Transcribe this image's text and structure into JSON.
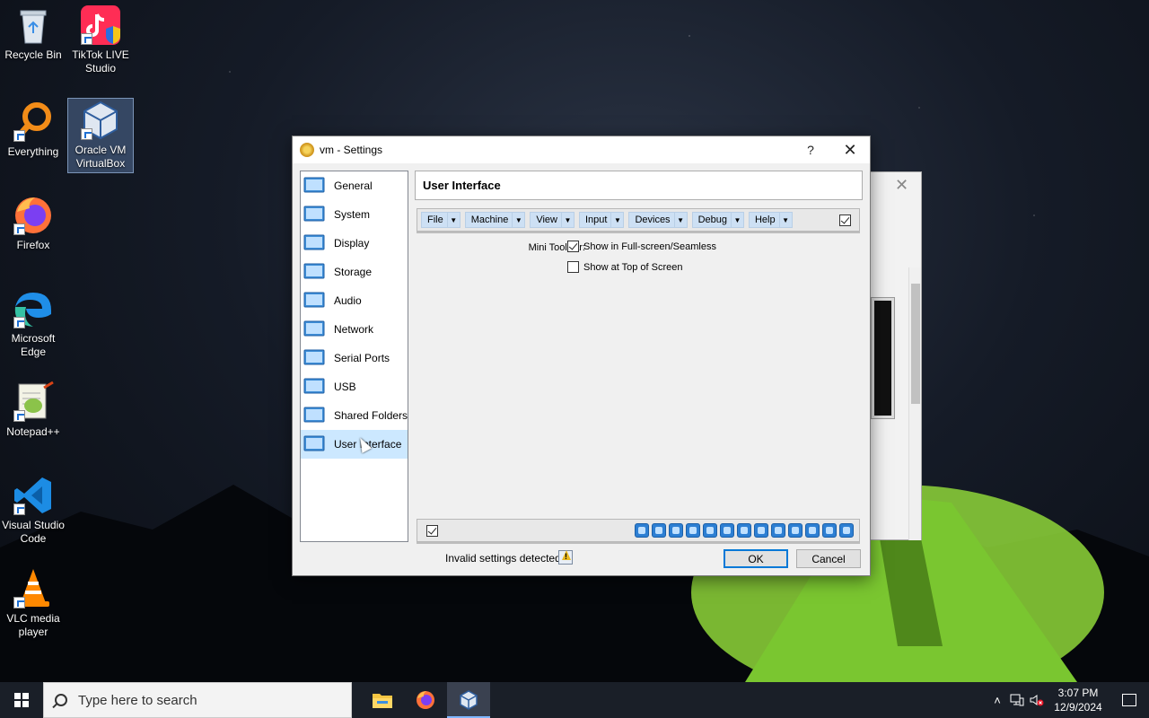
{
  "desktop": {
    "icons": [
      {
        "label": "Recycle Bin"
      },
      {
        "label": "TikTok LIVE Studio"
      },
      {
        "label": "Everything"
      },
      {
        "label": "Oracle VM VirtualBox"
      },
      {
        "label": "Firefox"
      },
      {
        "label": "Microsoft Edge"
      },
      {
        "label": "Notepad++"
      },
      {
        "label": "Visual Studio Code"
      },
      {
        "label": "VLC media player"
      }
    ]
  },
  "dialog": {
    "title": "vm - Settings",
    "help_glyph": "?",
    "close_glyph": "✕",
    "nav": [
      {
        "label": "General",
        "icon": "general-icon"
      },
      {
        "label": "System",
        "icon": "system-icon"
      },
      {
        "label": "Display",
        "icon": "display-icon"
      },
      {
        "label": "Storage",
        "icon": "storage-icon"
      },
      {
        "label": "Audio",
        "icon": "audio-icon"
      },
      {
        "label": "Network",
        "icon": "network-icon"
      },
      {
        "label": "Serial Ports",
        "icon": "serial-ports-icon"
      },
      {
        "label": "USB",
        "icon": "usb-icon"
      },
      {
        "label": "Shared Folders",
        "icon": "shared-folders-icon"
      },
      {
        "label": "User Interface",
        "icon": "user-interface-icon",
        "active": true
      }
    ],
    "page_title": "User Interface",
    "menubar": {
      "items": [
        "File",
        "Machine",
        "View",
        "Input",
        "Devices",
        "Debug",
        "Help"
      ],
      "enabled": true
    },
    "mini_toolbar": {
      "label": "Mini ToolBar:",
      "show_fullscreen": {
        "label": "Show in Full-screen/Seamless",
        "checked": true
      },
      "show_top": {
        "label": "Show at Top of Screen",
        "checked": false
      }
    },
    "statusbar": {
      "enabled": true,
      "icons": [
        "hard-disk-icon",
        "optical-drive-icon",
        "floppy-icon",
        "audio-icon",
        "network-icon",
        "usb-icon",
        "shared-folder-icon",
        "display-icon",
        "recording-icon",
        "mouse-integration-icon",
        "keyboard-icon",
        "cpu-icon",
        "download-icon"
      ]
    },
    "footer": {
      "message": "Invalid settings detected",
      "ok_label": "OK",
      "cancel_label": "Cancel"
    }
  },
  "taskbar": {
    "search_placeholder": "Type here to search",
    "apps": [
      "file-explorer-icon",
      "firefox-icon",
      "virtualbox-icon"
    ],
    "time": "3:07 PM",
    "date": "12/9/2024"
  }
}
